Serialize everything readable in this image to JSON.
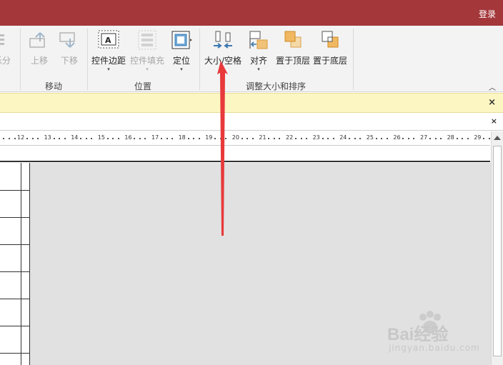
{
  "titlebar": {
    "login_label": "登录",
    "color": "#a4373a"
  },
  "ribbon": {
    "groups": [
      {
        "label": "移动",
        "buttons": [
          {
            "label": "上移",
            "enabled": false,
            "icon": "move-up-icon"
          },
          {
            "label": "下移",
            "enabled": false,
            "icon": "move-down-icon"
          }
        ]
      },
      {
        "label": "位置",
        "buttons": [
          {
            "label": "控件边距",
            "enabled": true,
            "icon": "control-margins-icon",
            "has_menu": true
          },
          {
            "label": "控件填充",
            "enabled": false,
            "icon": "control-padding-icon",
            "has_menu": true
          },
          {
            "label": "定位",
            "enabled": true,
            "icon": "anchoring-icon",
            "has_menu": true
          }
        ]
      },
      {
        "label": "调整大小和排序",
        "buttons": [
          {
            "label": "大小/空格",
            "enabled": true,
            "icon": "size-space-icon",
            "has_menu": true
          },
          {
            "label": "对齐",
            "enabled": true,
            "icon": "align-icon",
            "has_menu": true
          },
          {
            "label": "置于顶层",
            "enabled": true,
            "icon": "bring-to-front-icon"
          },
          {
            "label": "置于底层",
            "enabled": true,
            "icon": "send-to-back-icon"
          }
        ]
      }
    ],
    "partial_left_label": "乐分",
    "caret": "▾",
    "collapse_glyph": "︿"
  },
  "message_bar": {
    "close_glyph": "×",
    "color": "#fcf6c2"
  },
  "document": {
    "close_glyph": "×"
  },
  "ruler": {
    "numbers": [
      "12",
      "13",
      "14",
      "15",
      "16",
      "17",
      "18",
      "19",
      "20",
      "21",
      "22",
      "23",
      "24",
      "25",
      "26",
      "27",
      "28",
      "29"
    ]
  },
  "annotation": {
    "arrow_color": "#e8393b"
  },
  "watermark": {
    "brand": "Bai经验",
    "sub": "jingyan.baidu.com"
  }
}
